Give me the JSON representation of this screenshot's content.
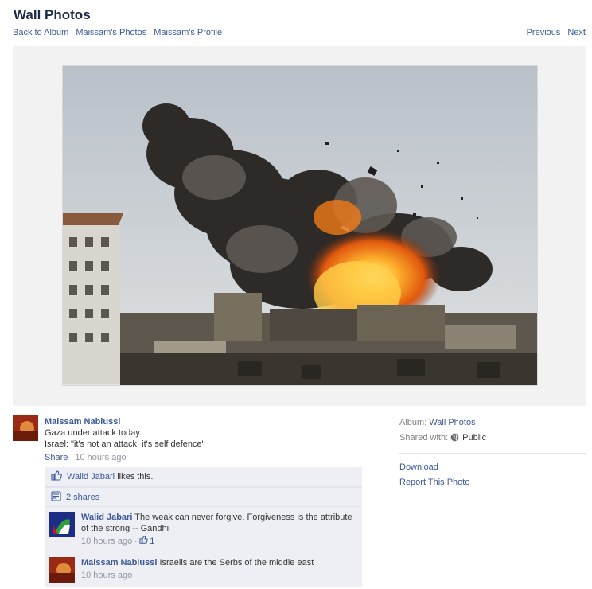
{
  "header": {
    "title": "Wall Photos",
    "nav_left": [
      "Back to Album",
      "Maissam's Photos",
      "Maissam's Profile"
    ],
    "nav_right": [
      "Previous",
      "Next"
    ]
  },
  "photo": {
    "icon": "photo-explosion"
  },
  "post": {
    "author": "Maissam Nablussi",
    "caption_line1": "Gaza under attack today.",
    "caption_line2": "Israel: \"it's not an attack, it's self defence\"",
    "share_label": "Share",
    "time": "10 hours ago"
  },
  "ufi": {
    "like_user": "Walid Jabari",
    "like_suffix": "likes this.",
    "shares": "2 shares",
    "comments": [
      {
        "author": "Walid Jabari",
        "text": "The weak can never forgive. Forgiveness is the attribute of the strong -- Gandhi",
        "time": "10 hours ago",
        "likes": "1"
      },
      {
        "author": "Maissam Nablussi",
        "text": "Israelis are the Serbs of the middle east",
        "time": "10 hours ago"
      }
    ]
  },
  "sidebar": {
    "album_label": "Album:",
    "album_value": "Wall Photos",
    "shared_label": "Shared with:",
    "shared_value": "Public",
    "download": "Download",
    "report": "Report This Photo"
  },
  "colors": {
    "link": "#3b5998",
    "ufi_background": "#edeff4",
    "stage_background": "#f2f2f2"
  }
}
